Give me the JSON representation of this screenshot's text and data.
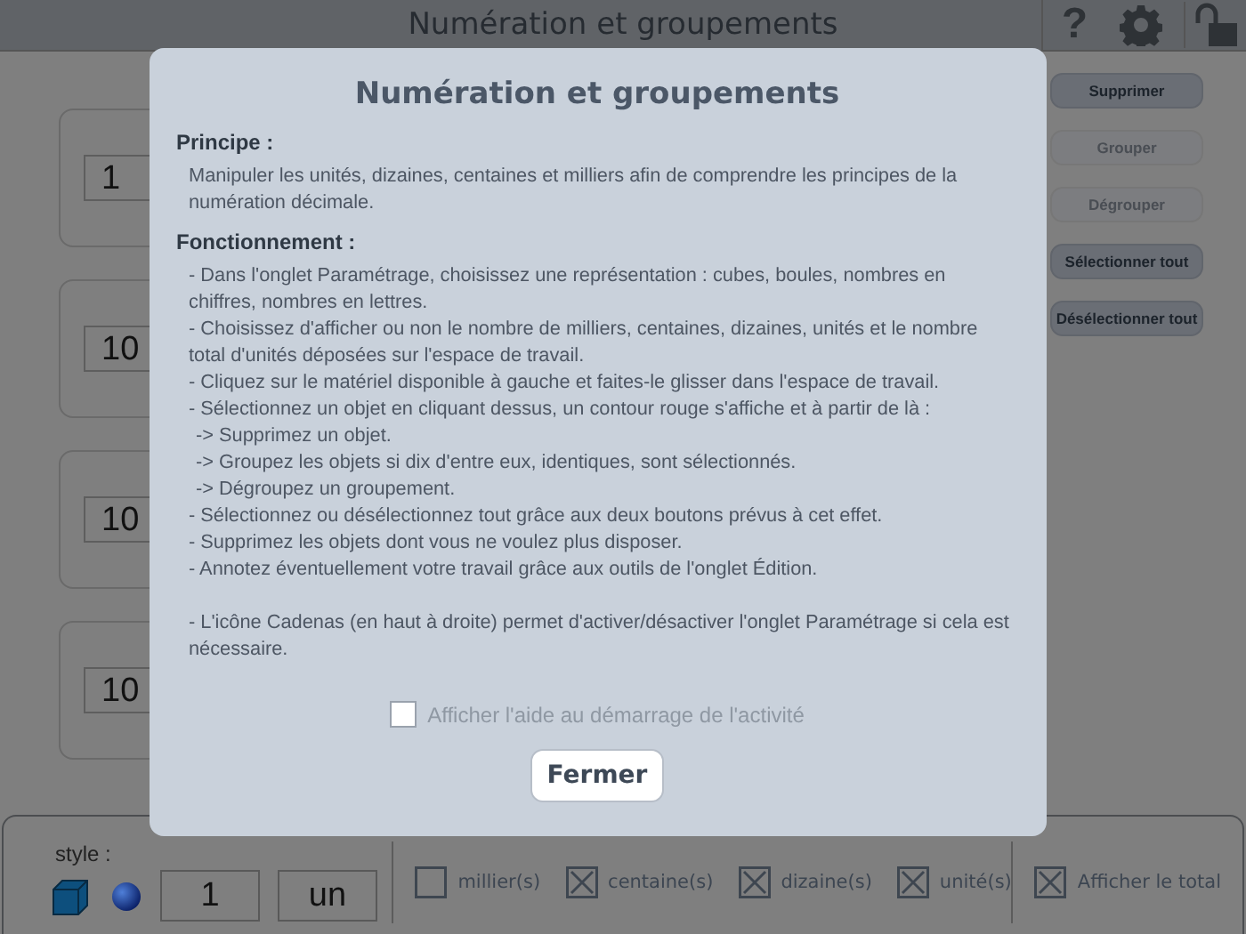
{
  "header": {
    "title": "Numération et groupements",
    "help": "?"
  },
  "workspace_cards": [
    {
      "value": "1"
    },
    {
      "value": "10"
    },
    {
      "value": "10"
    },
    {
      "value": "10"
    }
  ],
  "actions": [
    {
      "label": "Supprimer",
      "disabled": false
    },
    {
      "label": "Grouper",
      "disabled": true
    },
    {
      "label": "Dégrouper",
      "disabled": true
    },
    {
      "label": "Sélectionner tout",
      "disabled": false
    },
    {
      "label": "Désélectionner tout",
      "disabled": false
    }
  ],
  "dialog": {
    "title": "Numération et groupements",
    "sections": [
      {
        "heading": "Principe :",
        "lines": [
          {
            "kind": "item",
            "text": "Manipuler les unités, dizaines, centaines et milliers afin de comprendre les principes de la numération décimale."
          }
        ]
      },
      {
        "heading": "Fonctionnement :",
        "lines": [
          {
            "kind": "item",
            "text": "- Dans l'onglet Paramétrage, choisissez une représentation : cubes, boules, nombres en chiffres, nombres en lettres."
          },
          {
            "kind": "item",
            "text": "- Choisissez d'afficher ou non le nombre de milliers, centaines, dizaines, unités et le nombre total d'unités déposées sur l'espace de travail."
          },
          {
            "kind": "item",
            "text": "- Cliquez sur le matériel disponible à gauche et faites-le glisser dans l'espace de travail."
          },
          {
            "kind": "item",
            "text": "- Sélectionnez un objet en cliquant dessus, un contour rouge s'affiche et à partir de là :"
          },
          {
            "kind": "sub",
            "text": "-> Supprimez un objet."
          },
          {
            "kind": "sub",
            "text": "-> Groupez les objets si dix d'entre eux, identiques, sont sélectionnés."
          },
          {
            "kind": "sub",
            "text": "-> Dégroupez un groupement."
          },
          {
            "kind": "item",
            "text": "- Sélectionnez ou désélectionnez tout grâce aux deux boutons prévus à cet effet."
          },
          {
            "kind": "item",
            "text": "- Supprimez les objets dont vous ne voulez plus disposer."
          },
          {
            "kind": "item",
            "text": "- Annotez éventuellement votre travail grâce aux outils de l'onglet Édition."
          },
          {
            "kind": "note",
            "text": "- L'icône Cadenas (en haut à droite) permet d'activer/désactiver l'onglet Paramétrage si cela est nécessaire."
          }
        ]
      }
    ],
    "startup_help": {
      "label": "Afficher l'aide au démarrage de l'activité",
      "checked": false
    },
    "close_button": "Fermer"
  },
  "bottom_bar": {
    "style_label": "style :",
    "number_field": "1",
    "word_field": "un",
    "options": [
      {
        "label": "millier(s)",
        "checked": false
      },
      {
        "label": "centaine(s)",
        "checked": true
      },
      {
        "label": "dizaine(s)",
        "checked": true
      },
      {
        "label": "unité(s)",
        "checked": true
      }
    ],
    "show_total": {
      "label": "Afficher le total",
      "checked": true
    }
  }
}
